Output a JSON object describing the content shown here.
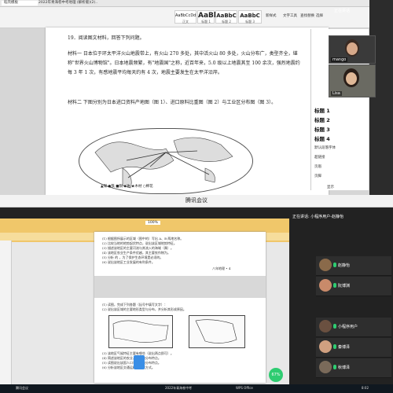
{
  "top_window": {
    "tabs": [
      "稻壳模板",
      "2022年青海卷中考地理 (解析版)(2)..",
      "",
      "",
      "",
      ""
    ],
    "ribbon": {
      "styles": [
        {
          "preview": "AaBbCcDd",
          "name": "正文"
        },
        {
          "preview": "AaBl",
          "name": "标题 1"
        },
        {
          "preview": "AaBbC",
          "name": "标题 2"
        },
        {
          "preview": "AaBbC",
          "name": "标题 3"
        }
      ],
      "buttons": [
        "新样式",
        "文字工具",
        "查找替换",
        "选择"
      ]
    },
    "document": {
      "question": "19．阅读图文材料，回答下列问题。",
      "material1": "材料一  日本位于环太平洋火山地震带上，有火山 270 多处，其中活火山 80 多处，火山分布广，类型齐全，堪称\"世界火山博物馆\"。日本地震频繁，有\"地震国\"之称，近百年来，5.0 级以上地震其至 100 余次，强烈地震约每 3 年 1 次，有感地震平均每天约有 4 次，地震主要发生在太平洋沿岸。",
      "material2": "材料二  下图分别为日本进口资料产地图（图 1）、进口原料比重图（图 2）与工业区分布图（图 3）。",
      "legend": "▲煤 ●铁 ■铜 ◆油 ★木材 ○棉花"
    },
    "style_panel": {
      "header": "样式和格式",
      "items": [
        "标题 1",
        "标题 2",
        "标题 3",
        "标题 4"
      ],
      "small_items": [
        "默认段落字体",
        "超链接",
        "页眉",
        "页脚"
      ],
      "footer": "显示",
      "footer2": "正文"
    },
    "videos": [
      {
        "name": "mango"
      },
      {
        "name": "Lisa"
      }
    ],
    "panel_top": "正在讲话"
  },
  "meeting": {
    "title": "腾讯会议",
    "speaking": "正在讲话: 小程序用户-赵静怡",
    "pdf": {
      "zoom": "100%",
      "zoom_badge": "67%",
      "page_label": "八年地理 • 4",
      "lines": [
        "(1) 根据图所展示的区域（图中的）写出 A、B 两地名称。",
        "(2) 比较当地的地势起伏特点，说出该区域地势特征。",
        "(3) 描述该地区的主要河流与其流入的海域（属）。",
        "(4) 该地区农业生产条件优越，其主要农作物为。",
        "(5) 分析 的 ，为了保护生态环境是必须的。",
        "(6) 说出该地区工业发展的有利条件。",
        "",
        "(1) 读图，完成下列各题（括号中填写文字）：",
        "(2) 说出该区域的主要地形类型与分布，并分析其形成原因。",
        "(3) 该地区气候特征主要有哪些（说出两点即可）。",
        "(4) 简述该地区的农业、工业的分布特点。",
        "(5) 读图说出该国人口与城市的分布特点。",
        "(6) 分析该地区交通运输的主要方式。"
      ]
    },
    "participants": [
      {
        "name": "赵静怡",
        "color": "#8a6a4a"
      },
      {
        "name": "阮博渊",
        "color": "#c98a6a"
      },
      {
        "name": "小程序用户",
        "color": "#6a5040"
      },
      {
        "name": "秦博泽",
        "color": "#d0a080"
      },
      {
        "name": "秋博泽",
        "color": "#7a6a5a"
      }
    ],
    "taskbar": [
      "腾讯会议",
      "2022年青海卷中考",
      "腾讯会议",
      "WPS Office"
    ],
    "time": "8:02"
  }
}
